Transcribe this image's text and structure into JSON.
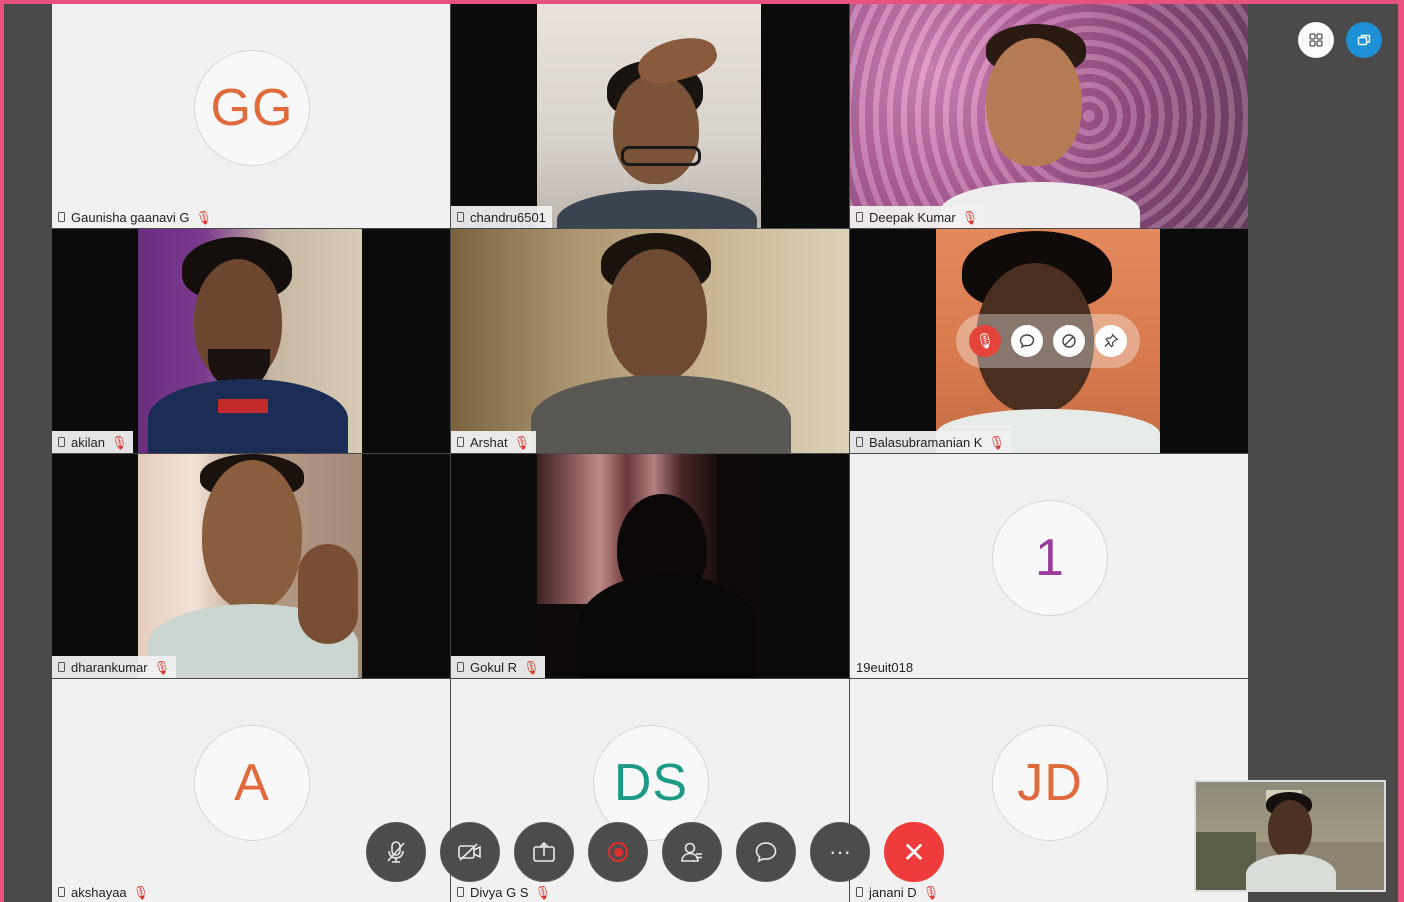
{
  "participants": [
    {
      "name": "Gaunisha gaanavi G",
      "initials": "GG",
      "initials_color": "#e06a3b",
      "video": false,
      "muted": true
    },
    {
      "name": "chandru6501",
      "video": true,
      "muted": false
    },
    {
      "name": "Deepak Kumar",
      "video": true,
      "muted": true
    },
    {
      "name": "akilan",
      "video": true,
      "muted": true
    },
    {
      "name": "Arshat",
      "video": true,
      "muted": true
    },
    {
      "name": "Balasubramanian K",
      "video": true,
      "muted": true
    },
    {
      "name": "dharankumar",
      "video": true,
      "muted": true
    },
    {
      "name": "Gokul R",
      "video": true,
      "muted": true
    },
    {
      "name": "19euit018",
      "initials": "1",
      "initials_color": "#9c3c9c",
      "video": false,
      "muted": false
    },
    {
      "name": "akshayaa",
      "initials": "A",
      "initials_color": "#e06a3b",
      "video": false,
      "muted": true
    },
    {
      "name": "Divya G S",
      "initials": "DS",
      "initials_color": "#1c9a86",
      "video": false,
      "muted": true
    },
    {
      "name": "janani D",
      "initials": "JD",
      "initials_color": "#e06a3b",
      "video": false,
      "muted": true
    }
  ],
  "hover_controls": [
    "mute-icon",
    "chat-icon",
    "stop-video-icon",
    "pin-icon"
  ],
  "toolbar": [
    "mic-muted-icon",
    "video-off-icon",
    "share-icon",
    "record-icon",
    "participants-icon",
    "chat-icon",
    "more-icon",
    "end-call-icon"
  ],
  "top_controls": [
    "grid-layout-icon",
    "popout-icon"
  ],
  "icons": {
    "more": "···",
    "end": "✕"
  }
}
